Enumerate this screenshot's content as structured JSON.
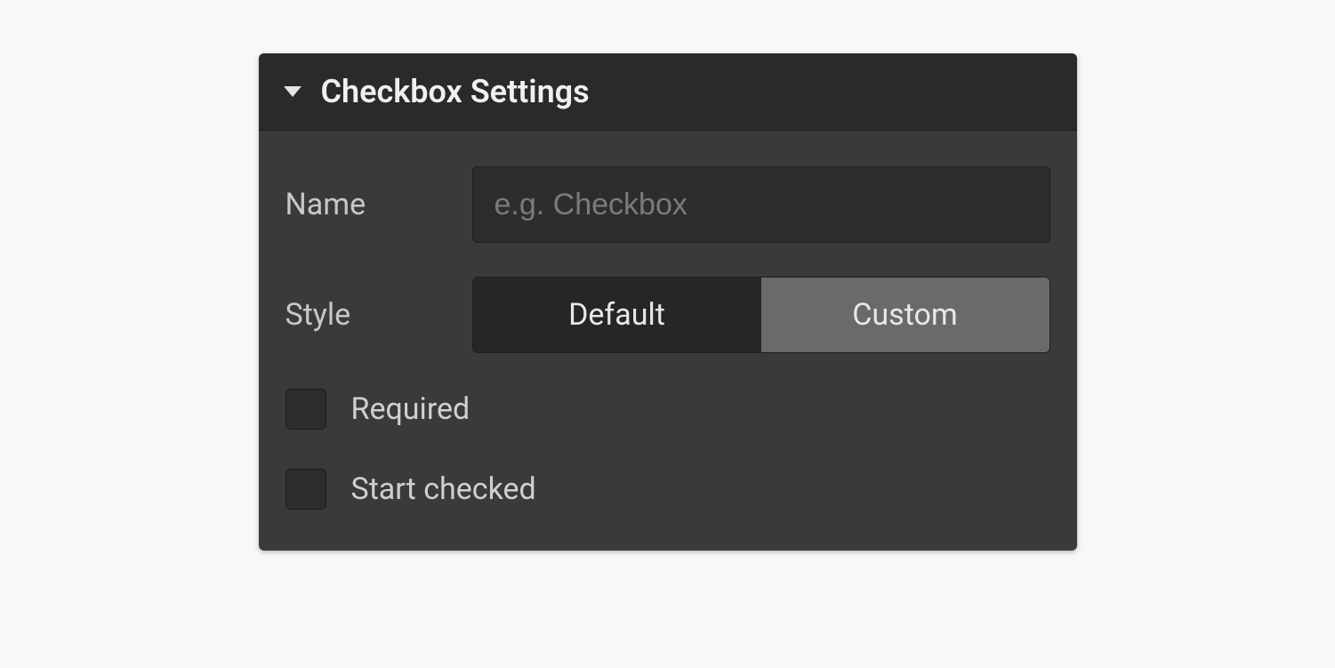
{
  "panel": {
    "title": "Checkbox Settings",
    "name_label": "Name",
    "name_value": "",
    "name_placeholder": "e.g. Checkbox",
    "style_label": "Style",
    "style_options": {
      "default": "Default",
      "custom": "Custom"
    },
    "style_selected": "Default",
    "required_label": "Required",
    "required_checked": false,
    "start_checked_label": "Start checked",
    "start_checked_checked": false
  }
}
